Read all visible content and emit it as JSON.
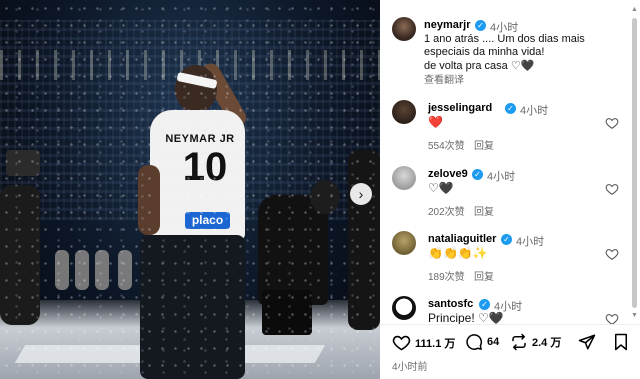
{
  "photo": {
    "jersey_name": "NEYMAR JR",
    "jersey_number": "10",
    "sponsor": "placo",
    "next_glyph": "›"
  },
  "post": {
    "author": "neymarjr",
    "time": "4小时",
    "caption_lines": [
      "1 ano atrás .... Um dos dias mais",
      "especiais da minha vida!",
      "de volta pra casa ♡🖤"
    ],
    "translate_label": "查看翻译"
  },
  "comments": [
    {
      "user": "jesselingard",
      "time": "4小时",
      "text": "❤️",
      "likes": "554次赞",
      "reply": "回复"
    },
    {
      "user": "zelove9",
      "time": "4小时",
      "text": "♡🖤",
      "likes": "202次赞",
      "reply": "回复"
    },
    {
      "user": "nataliaguitler",
      "time": "4小时",
      "text": "👏👏👏✨",
      "likes": "189次赞",
      "reply": "回复"
    },
    {
      "user": "santosfc",
      "time": "4小时",
      "text": "Principe! ♡🖤",
      "likes": "",
      "reply": ""
    }
  ],
  "actions": {
    "likes_count": "111.1 万",
    "comments_count": "64",
    "reposts_count": "2.4 万",
    "post_time": "4小时前"
  },
  "colors": {
    "verified": "#1d9bf0",
    "heart_red": "#ed4956",
    "muted_text": "#6b6b6b"
  },
  "icons": [
    "verified-badge-icon",
    "heart-icon",
    "comment-icon",
    "repost-icon",
    "share-icon",
    "save-icon",
    "carousel-next-icon"
  ]
}
